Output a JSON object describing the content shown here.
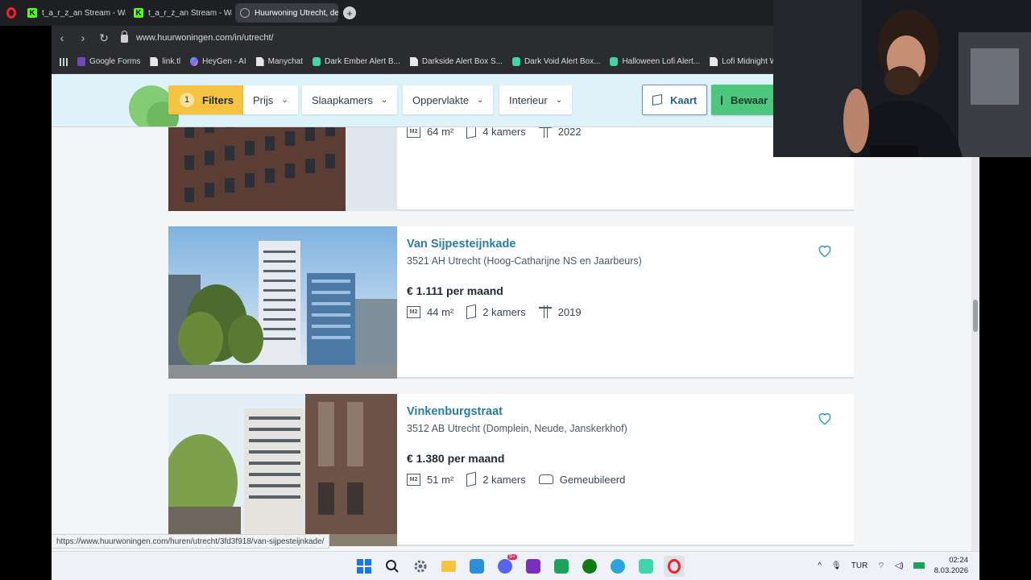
{
  "browser": {
    "tabs": [
      {
        "label": "t_a_r_z_an Stream - Watch",
        "icon": "kick-icon",
        "active": false
      },
      {
        "label": "t_a_r_z_an Stream - Watch",
        "icon": "kick-icon",
        "active": false
      },
      {
        "label": "Huurwoning Utrecht, de N",
        "icon": "globe-icon",
        "active": true
      }
    ],
    "url": "www.huurwoningen.com/in/utrecht/",
    "bookmarks": [
      {
        "label": "Google Forms",
        "icon": "forms"
      },
      {
        "label": "link.tl",
        "icon": "doc"
      },
      {
        "label": "HeyGen - AI",
        "icon": "heygen"
      },
      {
        "label": "Manychat",
        "icon": "doc"
      },
      {
        "label": "Dark Ember Alert B...",
        "icon": "se"
      },
      {
        "label": "Darkside Alert Box S...",
        "icon": "doc"
      },
      {
        "label": "Dark Void Alert Box...",
        "icon": "se"
      },
      {
        "label": "Halloween Lofi Alert...",
        "icon": "se"
      },
      {
        "label": "Lofi Midnight Widg...",
        "icon": "doc"
      }
    ]
  },
  "filters": {
    "filters_count": "1",
    "filters_label": "Filters",
    "prijs": "Prijs",
    "slaapkamers": "Slaapkamers",
    "oppervlakte": "Oppervlakte",
    "interieur": "Interieur",
    "kaart": "Kaart",
    "bewaar": "Bewaar"
  },
  "listings": [
    {
      "title": "",
      "address": "",
      "price": "",
      "features": [
        {
          "icon": "m2",
          "text": "64 m²"
        },
        {
          "icon": "door",
          "text": "4 kamers"
        },
        {
          "icon": "crane",
          "text": "2022"
        }
      ]
    },
    {
      "title": "Van Sijpesteijnkade",
      "address": "3521 AH Utrecht (Hoog-Catharijne NS en Jaarbeurs)",
      "price": "€ 1.111 per maand",
      "features": [
        {
          "icon": "m2",
          "text": "44 m²"
        },
        {
          "icon": "door",
          "text": "2 kamers"
        },
        {
          "icon": "crane",
          "text": "2019"
        }
      ]
    },
    {
      "title": "Vinkenburgstraat",
      "address": "3512 AB Utrecht (Domplein, Neude, Janskerkhof)",
      "price": "€ 1.380 per maand",
      "features": [
        {
          "icon": "m2",
          "text": "51 m²"
        },
        {
          "icon": "door",
          "text": "2 kamers"
        },
        {
          "icon": "sofa",
          "text": "Gemeubileerd"
        }
      ]
    }
  ],
  "m2_icon_text": "M2",
  "status_url": "https://www.huurwoningen.com/huren/utrecht/3fd3f918/van-sijpesteijnkade/",
  "taskbar": {
    "language": "TUR",
    "time": "02:24",
    "date": "8.03.2026",
    "discord_badge": "9+"
  },
  "colors": {
    "title": "#2b7c9e",
    "filters_button": "#f6c343",
    "bewaar_button": "#4cc77d",
    "heart": "#2b9ec4"
  }
}
